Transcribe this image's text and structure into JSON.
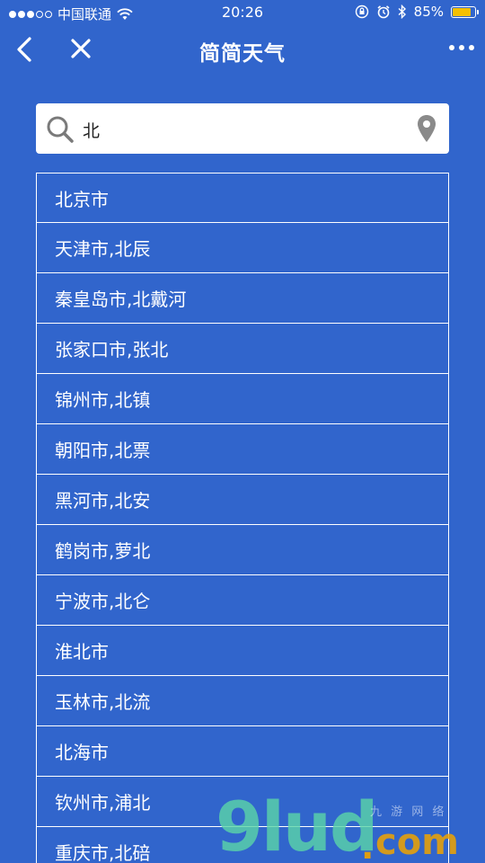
{
  "status_bar": {
    "carrier": "中国联通",
    "time": "20:26",
    "battery_percent": "85%",
    "battery_level": 0.85,
    "battery_color": "#f6c000",
    "icons": [
      "wifi-icon",
      "lock-rotation-icon",
      "alarm-icon",
      "bluetooth-icon"
    ]
  },
  "nav": {
    "title": "简简天气",
    "back_icon": "chevron-left-icon",
    "close_icon": "close-icon",
    "more_icon": "more-dots-icon"
  },
  "search": {
    "value": "北",
    "placeholder": "",
    "search_icon": "search-icon",
    "location_icon": "location-pin-icon"
  },
  "cities": [
    "北京市",
    "天津市,北辰",
    "秦皇岛市,北戴河",
    "张家口市,张北",
    "锦州市,北镇",
    "朝阳市,北票",
    "黑河市,北安",
    "鹤岗市,萝北",
    "宁波市,北仑",
    "淮北市",
    "玉林市,北流",
    "北海市",
    "钦州市,浦北",
    "重庆市,北碚"
  ],
  "watermark": {
    "brand": "9lud",
    "dot": ".",
    "tld": "com",
    "small": "九 游 网 络"
  },
  "colors": {
    "background": "#3165cc",
    "text": "#ffffff",
    "search_bg": "#ffffff",
    "icon_gray": "#8a8a8a"
  }
}
